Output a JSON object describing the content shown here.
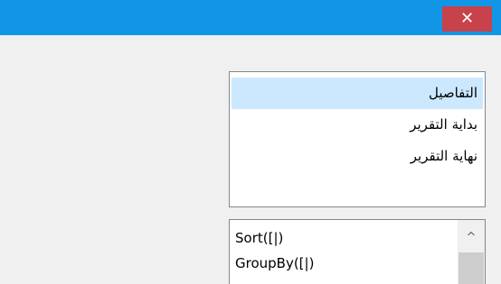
{
  "titlebar": {
    "close_label": "✕",
    "accent_color": "#1196e6",
    "close_color": "#c7424a"
  },
  "sections": {
    "items": [
      {
        "label": "التفاصيل",
        "selected": true
      },
      {
        "label": "بداية التقرير",
        "selected": false
      },
      {
        "label": "نهاية التقرير",
        "selected": false
      }
    ]
  },
  "functions": {
    "items": [
      {
        "label": "Sort([|)"
      },
      {
        "label": "GroupBy([|)"
      }
    ],
    "scroll_up_icon": "^"
  }
}
